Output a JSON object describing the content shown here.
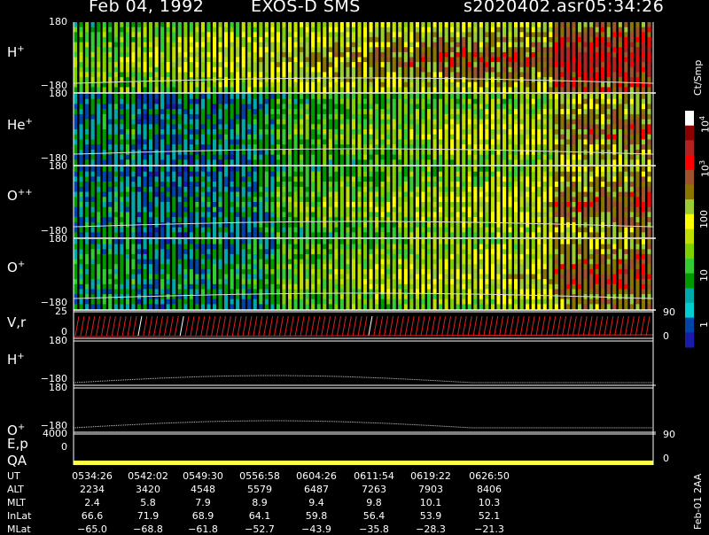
{
  "header": {
    "date": "Feb 04, 1992",
    "instrument": "EXOS-D SMS",
    "file": "s2020402.asr",
    "time": "05:34:26"
  },
  "colorbar": {
    "unit_label": "Ct/Smp",
    "tick_labels": [
      "10^4",
      "10^3",
      "100",
      "10",
      "1"
    ],
    "colors": [
      "#ffffff",
      "#8b0000",
      "#b22222",
      "#ff0000",
      "#a0522d",
      "#8b7500",
      "#9acd32",
      "#ffff00",
      "#c0e000",
      "#7fd000",
      "#32cd32",
      "#009900",
      "#00aaaa",
      "#00ced1",
      "#0044aa",
      "#1a1aaa"
    ]
  },
  "panels": [
    {
      "label": "H",
      "sup": "+",
      "ymax": "180",
      "ymin": "−180"
    },
    {
      "label": "He",
      "sup": "+",
      "ymax": "180",
      "ymin": "−180"
    },
    {
      "label": "O",
      "sup": "++",
      "ymax": "180",
      "ymin": "−180"
    },
    {
      "label": "O",
      "sup": "+",
      "ymax": "180",
      "ymin": "−180"
    },
    {
      "label": "V,r",
      "sup": "",
      "ymax": "25",
      "ymin": "0",
      "rtop": "90",
      "rbot": "0"
    },
    {
      "label": "H",
      "sup": "+",
      "ymax": "180",
      "ymin": "−180"
    },
    {
      "label": "O",
      "sup": "+",
      "ymax": "180",
      "ymin": "−180"
    },
    {
      "label": "E,p",
      "sup": "",
      "ymax": "4000",
      "ymin": "",
      "rtop": "90",
      "rbot": ""
    },
    {
      "label": "QA",
      "sup": "",
      "ymax": "0",
      "ymin": "",
      "rtop": "0",
      "rbot": ""
    }
  ],
  "table": {
    "rows": [
      {
        "label": "UT",
        "values": [
          "0534:26",
          "0542:02",
          "0549:30",
          "0556:58",
          "0604:26",
          "0611:54",
          "0619:22",
          "0626:50"
        ]
      },
      {
        "label": "ALT",
        "values": [
          "2234",
          "3420",
          "4548",
          "5579",
          "6487",
          "7263",
          "7903",
          "8406"
        ]
      },
      {
        "label": "MLT",
        "values": [
          "2.4",
          "5.8",
          "7.9",
          "8.9",
          "9.4",
          "9.8",
          "10.1",
          "10.3"
        ]
      },
      {
        "label": "InLat",
        "values": [
          "66.6",
          "71.9",
          "68.9",
          "64.1",
          "59.8",
          "56.4",
          "53.9",
          "52.1"
        ]
      },
      {
        "label": "MLat",
        "values": [
          "−65.0",
          "−68.8",
          "−61.8",
          "−52.7",
          "−43.9",
          "−35.8",
          "−28.3",
          "−21.3"
        ]
      }
    ]
  },
  "footer": {
    "stamp": "Feb-01 2AA"
  },
  "chart_data": {
    "type": "heatmap",
    "title": "Feb 04, 1992   EXOS-D SMS",
    "x_labels": [
      "0534:26",
      "0542:02",
      "0549:30",
      "0556:58",
      "0604:26",
      "0611:54",
      "0619:22",
      "0626:50"
    ],
    "ion_spectrograms": [
      "H+",
      "He+",
      "O++",
      "O+"
    ],
    "pitch_angle_range": [
      -180,
      180
    ],
    "colorbar_range": [
      1,
      10000
    ],
    "colorbar_scale": "log"
  }
}
